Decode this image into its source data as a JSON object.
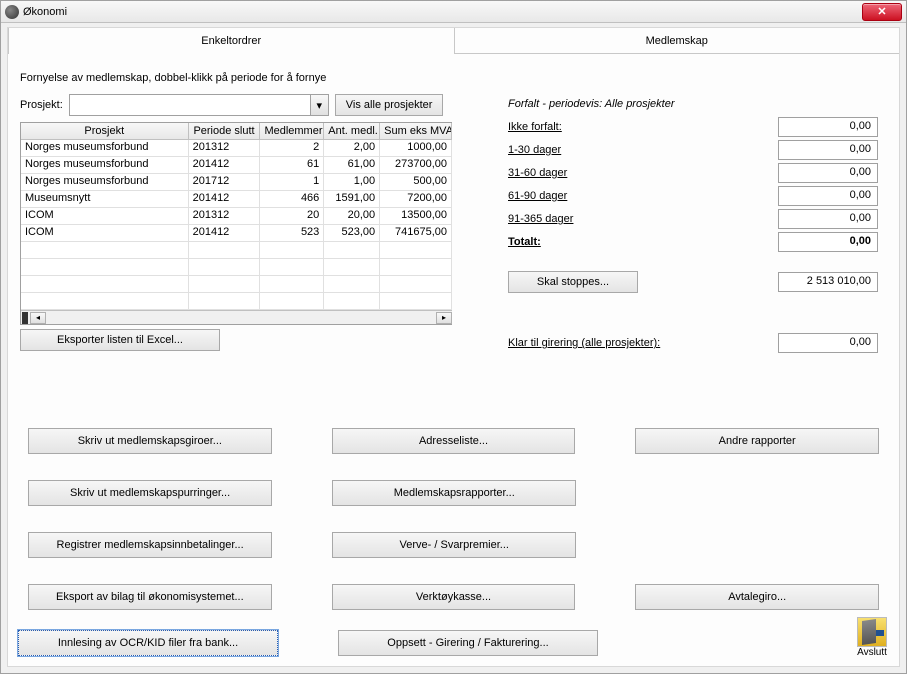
{
  "window": {
    "title": "Økonomi"
  },
  "tabs": {
    "left": "Enkeltordrer",
    "right": "Medlemskap"
  },
  "instruction": "Fornyelse av medlemskap, dobbel-klikk på periode for å fornye",
  "project": {
    "label": "Prosjekt:",
    "show_all": "Vis alle prosjekter"
  },
  "grid": {
    "headers": [
      "Prosjekt",
      "Periode slutt",
      "Medlemmer",
      "Ant. medl.",
      "Sum eks MVA"
    ],
    "rows": [
      [
        "Norges museumsforbund",
        "201312",
        "2",
        "2,00",
        "1000,00"
      ],
      [
        "Norges museumsforbund",
        "201412",
        "61",
        "61,00",
        "273700,00"
      ],
      [
        "Norges museumsforbund",
        "201712",
        "1",
        "1,00",
        "500,00"
      ],
      [
        "Museumsnytt",
        "201412",
        "466",
        "1591,00",
        "7200,00"
      ],
      [
        "ICOM",
        "201312",
        "20",
        "20,00",
        "13500,00"
      ],
      [
        "ICOM",
        "201412",
        "523",
        "523,00",
        "741675,00"
      ]
    ]
  },
  "export_list": "Eksporter listen til Excel...",
  "forfalt": {
    "title": "Forfalt - periodevis: Alle prosjekter",
    "rows": [
      {
        "label": "Ikke forfalt:",
        "value": "0,00"
      },
      {
        "label": "1-30 dager",
        "value": "0,00"
      },
      {
        "label": "31-60 dager",
        "value": "0,00"
      },
      {
        "label": "61-90 dager",
        "value": "0,00"
      },
      {
        "label": "91-365 dager",
        "value": "0,00"
      }
    ],
    "total_label": "Totalt:",
    "total_value": "0,00"
  },
  "skal_stoppes": {
    "label": "Skal stoppes...",
    "value": "2 513 010,00"
  },
  "girering": {
    "label": "Klar til girering (alle prosjekter):",
    "value": "0,00"
  },
  "buttons": {
    "r1c1": "Skriv ut medlemskapsgiroer...",
    "r1c2": "Adresseliste...",
    "r1c3": "Andre rapporter",
    "r2c1": "Skriv ut medlemskapspurringer...",
    "r2c2": "Medlemskapsrapporter...",
    "r3c1": "Registrer medlemskapsinnbetalinger...",
    "r3c2": "Verve- / Svarpremier...",
    "r4c1": "Eksport av bilag til økonomisystemet...",
    "r4c2": "Verktøykasse...",
    "r4c3": "Avtalegiro...",
    "ocr": "Innlesing av OCR/KID filer fra bank...",
    "oppsett": "Oppsett - Girering / Fakturering..."
  },
  "exit_label": "Avslutt"
}
